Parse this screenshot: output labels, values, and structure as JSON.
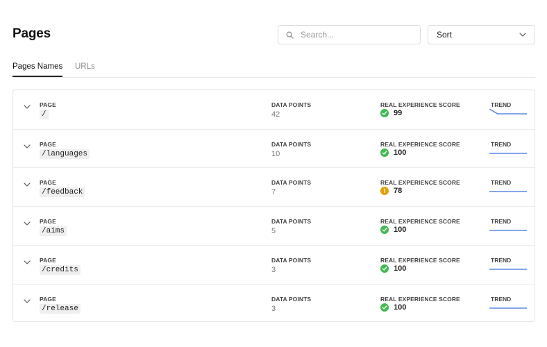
{
  "header": {
    "title": "Pages",
    "search_placeholder": "Search...",
    "sort_label": "Sort"
  },
  "tabs": [
    {
      "label": "Pages Names",
      "active": true
    },
    {
      "label": "URLs",
      "active": false
    }
  ],
  "columns": {
    "page": "PAGE",
    "data_points": "DATA POINTS",
    "score": "REAL EXPERIENCE SCORE",
    "trend": "TREND"
  },
  "rows": [
    {
      "page": "/",
      "data_points": "42",
      "score": "99",
      "status": "good",
      "trend": [
        1.0,
        0.0,
        0.0
      ]
    },
    {
      "page": "/languages",
      "data_points": "10",
      "score": "100",
      "status": "good",
      "trend": [
        0.0,
        0.0,
        0.0
      ]
    },
    {
      "page": "/feedback",
      "data_points": "7",
      "score": "78",
      "status": "warning",
      "trend": [
        0.0,
        0.0,
        0.0
      ]
    },
    {
      "page": "/aims",
      "data_points": "5",
      "score": "100",
      "status": "good",
      "trend": [
        0.0,
        0.0,
        0.0
      ]
    },
    {
      "page": "/credits",
      "data_points": "3",
      "score": "100",
      "status": "good",
      "trend": [
        0.0,
        0.0,
        0.0
      ]
    },
    {
      "page": "/release",
      "data_points": "3",
      "score": "100",
      "status": "good",
      "trend": [
        0.0,
        0.0,
        0.0
      ]
    }
  ],
  "colors": {
    "good": "#3fb950",
    "warning": "#e3a008",
    "trend_line": "#3b6fe0"
  }
}
